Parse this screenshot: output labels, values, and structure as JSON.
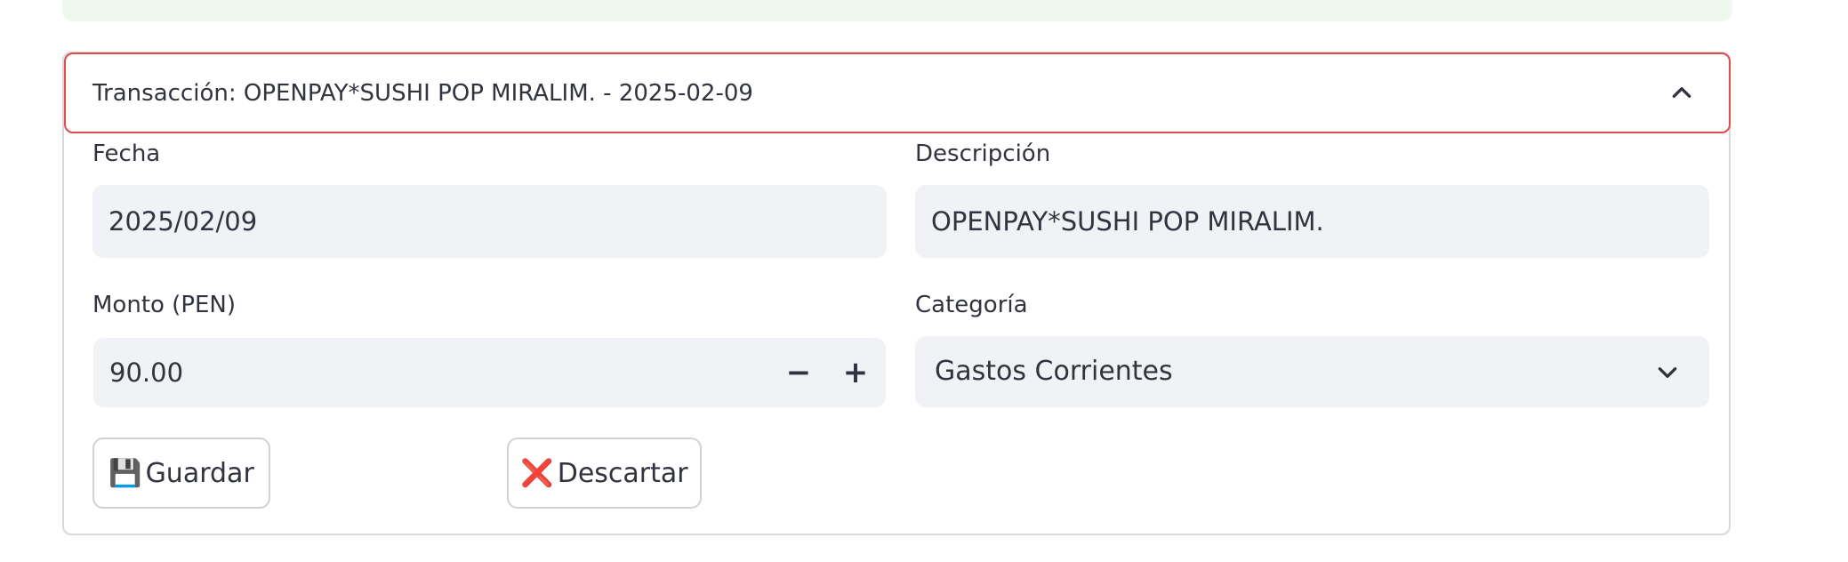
{
  "expander": {
    "title": "Transacción: OPENPAY*SUSHI POP MIRALIM. - 2025-02-09"
  },
  "form": {
    "date": {
      "label": "Fecha",
      "value": "2025/02/09"
    },
    "description": {
      "label": "Descripción",
      "value": "OPENPAY*SUSHI POP MIRALIM."
    },
    "amount": {
      "label": "Monto (PEN)",
      "value": "90.00",
      "decrement": "−",
      "increment": "+"
    },
    "category": {
      "label": "Categoría",
      "selected": "Gastos Corrientes"
    }
  },
  "buttons": {
    "save_icon": "💾",
    "save_label": "Guardar",
    "discard_icon": "❌",
    "discard_label": "Descartar"
  },
  "icons": {
    "expander_toggle": "chevron-up-icon",
    "select_toggle": "chevron-down-icon",
    "save": "floppy-disk-icon",
    "discard": "red-x-icon"
  },
  "colors": {
    "banner_bg": "#eef8ee",
    "header_border": "#e04b4b",
    "input_bg": "#f0f2f6",
    "text": "#31333f",
    "discard_icon": "#d93025"
  }
}
